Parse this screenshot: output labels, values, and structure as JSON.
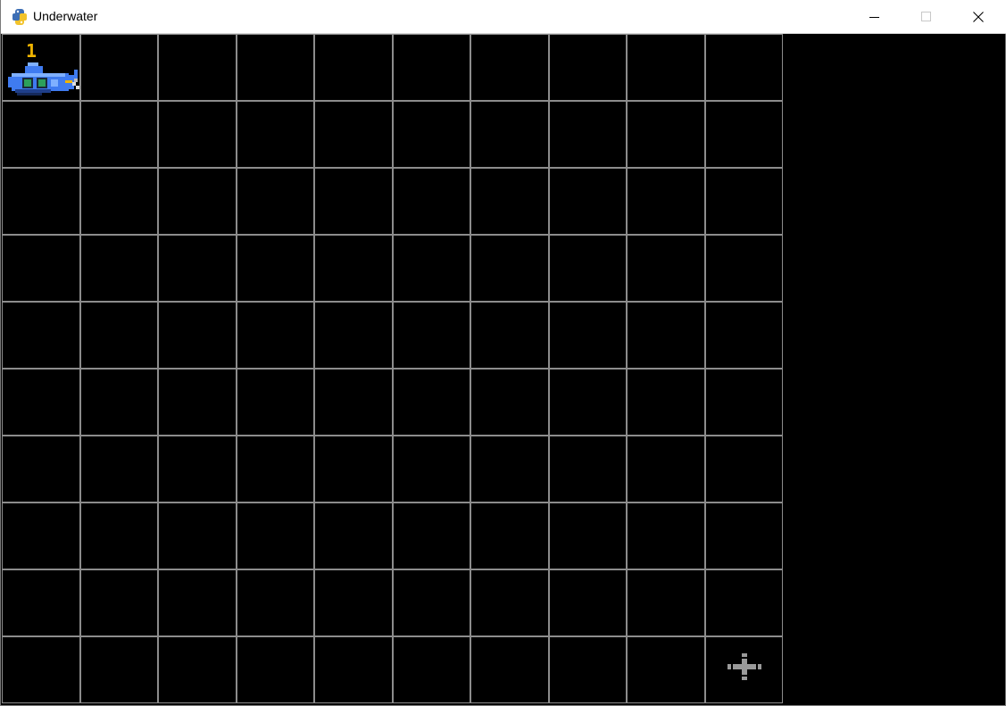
{
  "window": {
    "title": "Underwater",
    "icon": "python-logo-icon",
    "controls": [
      "minimize-icon",
      "maximize-icon",
      "close-icon"
    ]
  },
  "board": {
    "rows": 10,
    "cols": 10,
    "background": "#000000",
    "grid_color": "#8c8c8c"
  },
  "player": {
    "sprite": "submarine-icon",
    "cell": {
      "row": 0,
      "col": 0
    },
    "number": "1",
    "number_color": "#f0b400",
    "hull_color": "#3f7bf0",
    "porthole_color": "#2ca05a"
  },
  "target": {
    "sprite": "crosshair-icon",
    "cell": {
      "row": 9,
      "col": 9
    },
    "color": "#9a9a9a"
  }
}
